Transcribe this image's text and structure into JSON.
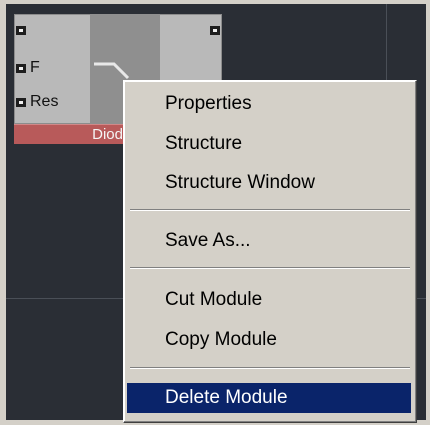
{
  "module": {
    "title": "Diode L",
    "inputs": [
      {
        "label": "F"
      },
      {
        "label": "Res"
      }
    ]
  },
  "context_menu": {
    "items": [
      {
        "label": "Properties",
        "selected": false
      },
      {
        "label": "Structure",
        "selected": false
      },
      {
        "label": "Structure Window",
        "selected": false
      },
      {
        "label": "Save As...",
        "selected": false
      },
      {
        "label": "Cut Module",
        "selected": false
      },
      {
        "label": "Copy Module",
        "selected": false
      },
      {
        "label": "Delete Module",
        "selected": true
      }
    ],
    "selection_color": "#0a246a"
  },
  "colors": {
    "canvas": "#2a2e35",
    "module_title_bar": "#b85a5a",
    "menu_background": "#d4d0c8"
  }
}
